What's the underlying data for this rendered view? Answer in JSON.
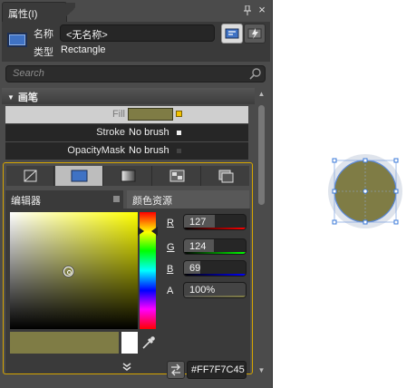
{
  "window": {
    "title": "属性(I)"
  },
  "object": {
    "name_label": "名称",
    "name_value": "<无名称>",
    "type_label": "类型",
    "type_value": "Rectangle"
  },
  "search": {
    "placeholder": "Search"
  },
  "section": {
    "title": "画笔"
  },
  "properties": [
    {
      "name": "Fill",
      "value": ""
    },
    {
      "name": "Stroke",
      "value": "No brush"
    },
    {
      "name": "OpacityMask",
      "value": "No brush"
    }
  ],
  "editor": {
    "tab_editor": "编辑器",
    "tab_resources": "颜色资源",
    "channels": [
      {
        "label": "R",
        "value": "127",
        "level": 0.498,
        "bar": "linear-gradient(to right,#000,#f00)"
      },
      {
        "label": "G",
        "value": "124",
        "level": 0.486,
        "bar": "linear-gradient(to right,#000,#0f0)"
      },
      {
        "label": "B",
        "value": "69",
        "level": 0.27,
        "bar": "linear-gradient(to right,#000,#00f)"
      },
      {
        "label": "A",
        "value": "100%",
        "level": 1.0,
        "bar": "linear-gradient(to right,#555,#7f7c45)"
      }
    ],
    "hex": "#FF7F7C45"
  },
  "colors": {
    "fill": "#7f7c45",
    "selection": "#3a78d8"
  }
}
